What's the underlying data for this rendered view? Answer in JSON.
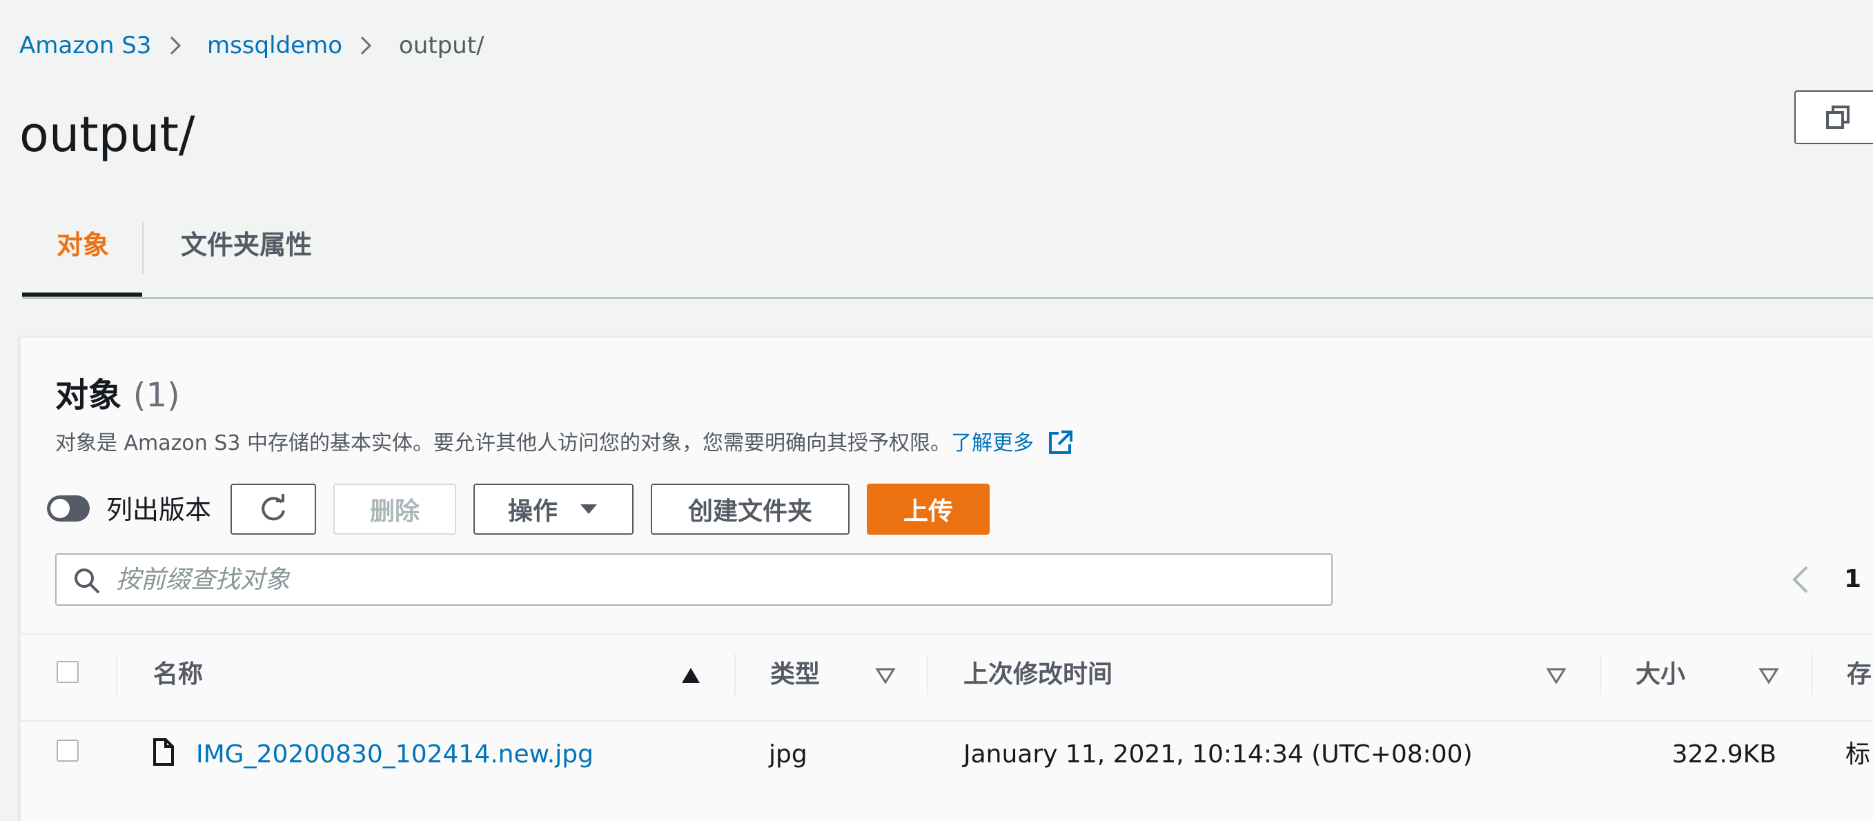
{
  "breadcrumb": [
    "Amazon S3",
    "mssqldemo",
    "output/"
  ],
  "page_title": "output/",
  "tabs": [
    "对象",
    "文件夹属性"
  ],
  "objects_panel": {
    "heading": "对象",
    "count": "(1)",
    "description": "对象是 Amazon S3 中存储的基本实体。要允许其他人访问您的对象，您需要明确向其授予权限。",
    "learn_more": "了解更多"
  },
  "toolbar": {
    "versions_toggle_label": "列出版本",
    "delete_label": "删除",
    "actions_label": "操作",
    "create_folder_label": "创建文件夹",
    "upload_label": "上传"
  },
  "search": {
    "placeholder": "按前缀查找对象",
    "value": ""
  },
  "pagination": {
    "current_page": "1"
  },
  "table": {
    "columns": [
      "名称",
      "类型",
      "上次修改时间",
      "大小",
      "存"
    ],
    "rows": [
      {
        "name": "IMG_20200830_102414.new.jpg",
        "type": "jpg",
        "last_modified": "January 11, 2021, 10:14:34 (UTC+08:00)",
        "size": "322.9KB",
        "storage_class": "标"
      }
    ]
  },
  "colors": {
    "accent": "#ec7211",
    "link": "#0073bb",
    "text": "#16191f",
    "muted": "#545b64",
    "background": "#f2f3f3"
  }
}
